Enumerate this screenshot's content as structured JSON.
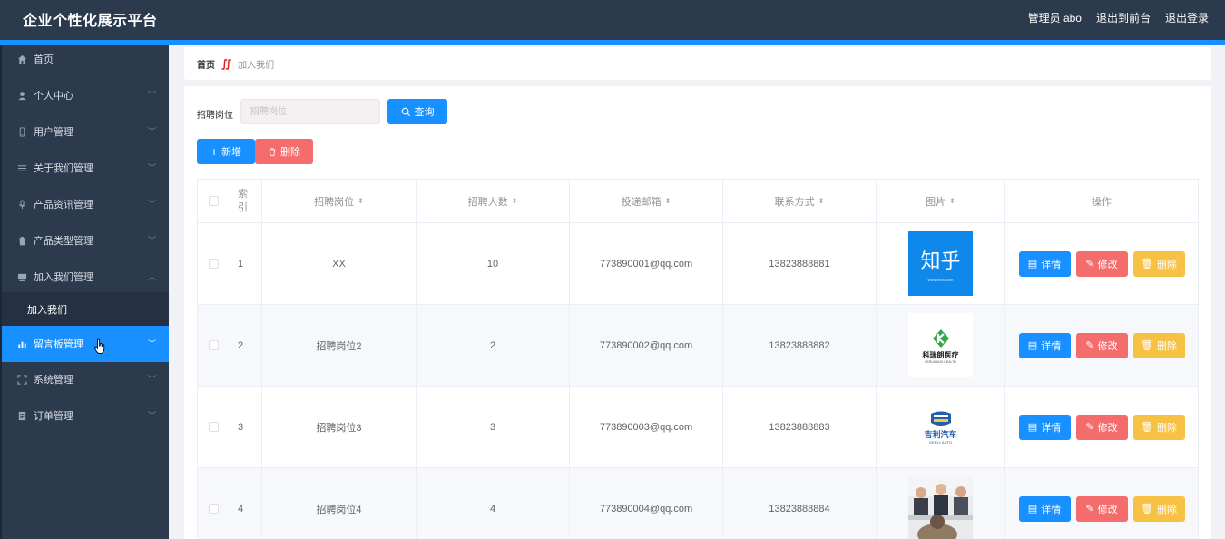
{
  "header": {
    "title": "企业个性化展示平台",
    "admin": "管理员 abo",
    "front": "退出到前台",
    "logout": "退出登录"
  },
  "sidebar": {
    "items": [
      {
        "label": "首页",
        "icon": "home-icon",
        "expandable": false
      },
      {
        "label": "个人中心",
        "icon": "user-icon",
        "expandable": true
      },
      {
        "label": "用户管理",
        "icon": "phone-icon",
        "expandable": true
      },
      {
        "label": "关于我们管理",
        "icon": "menu-icon",
        "expandable": true
      },
      {
        "label": "产品资讯管理",
        "icon": "mic-icon",
        "expandable": true
      },
      {
        "label": "产品类型管理",
        "icon": "trash-icon",
        "expandable": true
      },
      {
        "label": "加入我们管理",
        "icon": "monitor-icon",
        "expandable": true,
        "expanded": true
      },
      {
        "label": "留言板管理",
        "icon": "chart-icon",
        "expandable": true,
        "active": true
      },
      {
        "label": "系统管理",
        "icon": "fullscreen-icon",
        "expandable": true
      },
      {
        "label": "订单管理",
        "icon": "document-icon",
        "expandable": true
      }
    ],
    "sub_item": "加入我们"
  },
  "breadcrumb": {
    "home": "首页",
    "current": "加入我们"
  },
  "search": {
    "label": "招聘岗位",
    "placeholder": "招聘岗位",
    "button": "查询"
  },
  "toolbar": {
    "add": "新增",
    "delete": "删除"
  },
  "table": {
    "headers": [
      "索引",
      "招聘岗位",
      "招聘人数",
      "投递邮箱",
      "联系方式",
      "图片",
      "操作"
    ],
    "rows": [
      {
        "index": "1",
        "position": "XX",
        "count": "10",
        "email": "773890001@qq.com",
        "phone": "13823888881",
        "image": "zhihu-logo",
        "image_text": "知乎",
        "image_sub": "www.zhihu.com"
      },
      {
        "index": "2",
        "position": "招聘岗位2",
        "count": "2",
        "email": "773890002@qq.com",
        "phone": "13823888882",
        "image": "kerulang-logo",
        "image_text": "科瑞朗医疗",
        "image_sub": "KERUILANG HEALTH"
      },
      {
        "index": "3",
        "position": "招聘岗位3",
        "count": "3",
        "email": "773890003@qq.com",
        "phone": "13823888883",
        "image": "geely-logo",
        "image_text": "吉利汽车",
        "image_sub": "GEELY AUTO"
      },
      {
        "index": "4",
        "position": "招聘岗位4",
        "count": "4",
        "email": "773890004@qq.com",
        "phone": "13823888884",
        "image": "meeting-photo"
      }
    ],
    "actions": {
      "detail": "详情",
      "edit": "修改",
      "delete": "删除"
    }
  },
  "colors": {
    "header_bg": "#2b3a4d",
    "accent": "#1890ff",
    "danger": "#f56c6c",
    "warning": "#f7c143"
  }
}
